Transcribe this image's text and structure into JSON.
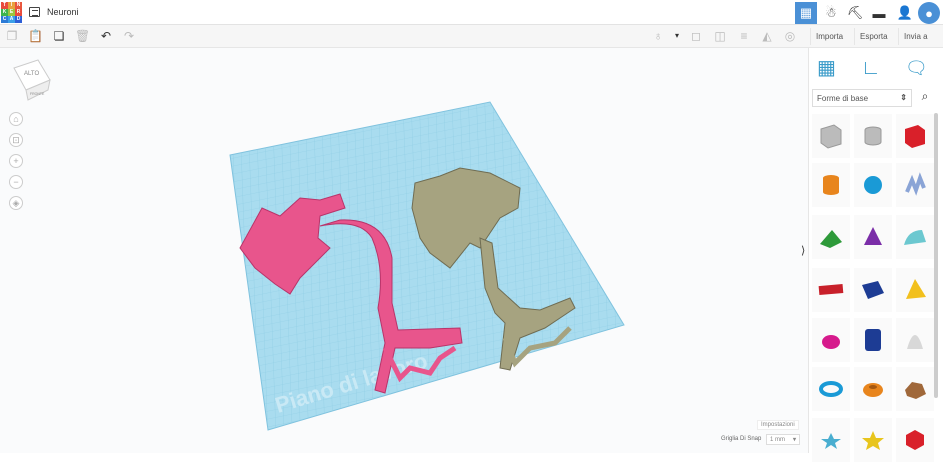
{
  "header": {
    "logo_letters": [
      "T",
      "I",
      "N",
      "K",
      "E",
      "R",
      "C",
      "A",
      "D"
    ],
    "title": "Neuroni"
  },
  "toolbar": {
    "import_label": "Importa",
    "export_label": "Esporta",
    "send_label": "Invia a"
  },
  "viewcube": {
    "top_label": "ALTO",
    "front_label": "FRONTE"
  },
  "workplane": {
    "label": "Piano di lavoro"
  },
  "panel": {
    "category": "Forme di base",
    "collapse": "⟩"
  },
  "footer": {
    "settings_label": "Impostazioni",
    "snap_label": "Griglia Di Snap",
    "snap_value": "1 mm"
  },
  "colors": {
    "accent": "#4a90d6",
    "plane": "#a9dcef",
    "neuron_pink": "#e8558c",
    "neuron_olive": "#a6a380"
  }
}
